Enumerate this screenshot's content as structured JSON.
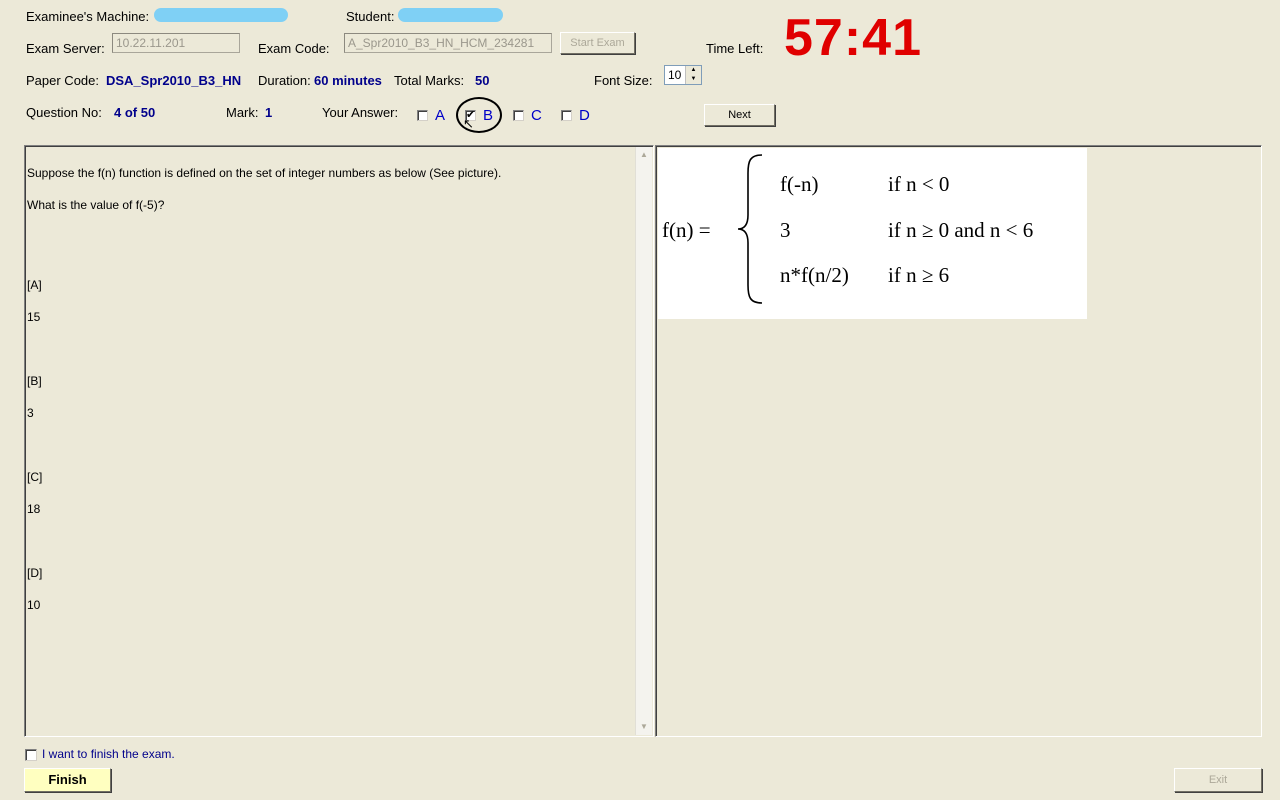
{
  "header": {
    "examinee_label": "Examinee's Machine:",
    "student_label": "Student:",
    "exam_server_label": "Exam Server:",
    "exam_server_value": "10.22.11.201",
    "exam_code_label": "Exam Code:",
    "exam_code_value": "A_Spr2010_B3_HN_HCM_234281",
    "start_exam_label": "Start Exam",
    "time_left_label": "Time Left:",
    "time_left_value": "57:41",
    "paper_code_label": "Paper Code:",
    "paper_code_value": "DSA_Spr2010_B3_HN",
    "duration_label": "Duration:",
    "duration_value": "60 minutes",
    "total_marks_label": "Total Marks:",
    "total_marks_value": "50",
    "font_size_label": "Font Size:",
    "font_size_value": "10"
  },
  "question_bar": {
    "question_no_label": "Question No:",
    "question_no_value": "4 of 50",
    "mark_label": "Mark:",
    "mark_value": "1",
    "your_answer_label": "Your Answer:",
    "options": [
      {
        "label": "A",
        "checked": false
      },
      {
        "label": "B",
        "checked": true
      },
      {
        "label": "C",
        "checked": false
      },
      {
        "label": "D",
        "checked": false
      }
    ],
    "next_label": "Next"
  },
  "question": {
    "text_line1": "Suppose  the f(n) function is defined on the set of integer numbers as below (See picture).",
    "text_line2": "What is the value of  f(-5)?",
    "answers": [
      {
        "tag": "[A]",
        "value": "15"
      },
      {
        "tag": "[B]",
        "value": "3"
      },
      {
        "tag": "[C]",
        "value": "18"
      },
      {
        "tag": "[D]",
        "value": "10"
      }
    ]
  },
  "formula": {
    "lhs": "f(n)  =",
    "rows": [
      {
        "expr": "f(-n)",
        "cond": "if n < 0"
      },
      {
        "expr": "3",
        "cond": "if n ≥ 0  and  n < 6"
      },
      {
        "expr": "n*f(n/2)",
        "cond": "if n ≥ 6"
      }
    ]
  },
  "footer": {
    "finish_checkbox_label": "I want to finish the exam.",
    "finish_label": "Finish",
    "exit_label": "Exit"
  },
  "colors": {
    "background": "#ece9d8",
    "timer": "#e00000",
    "value_text": "#00008b",
    "finish_button": "#ffffc0"
  }
}
